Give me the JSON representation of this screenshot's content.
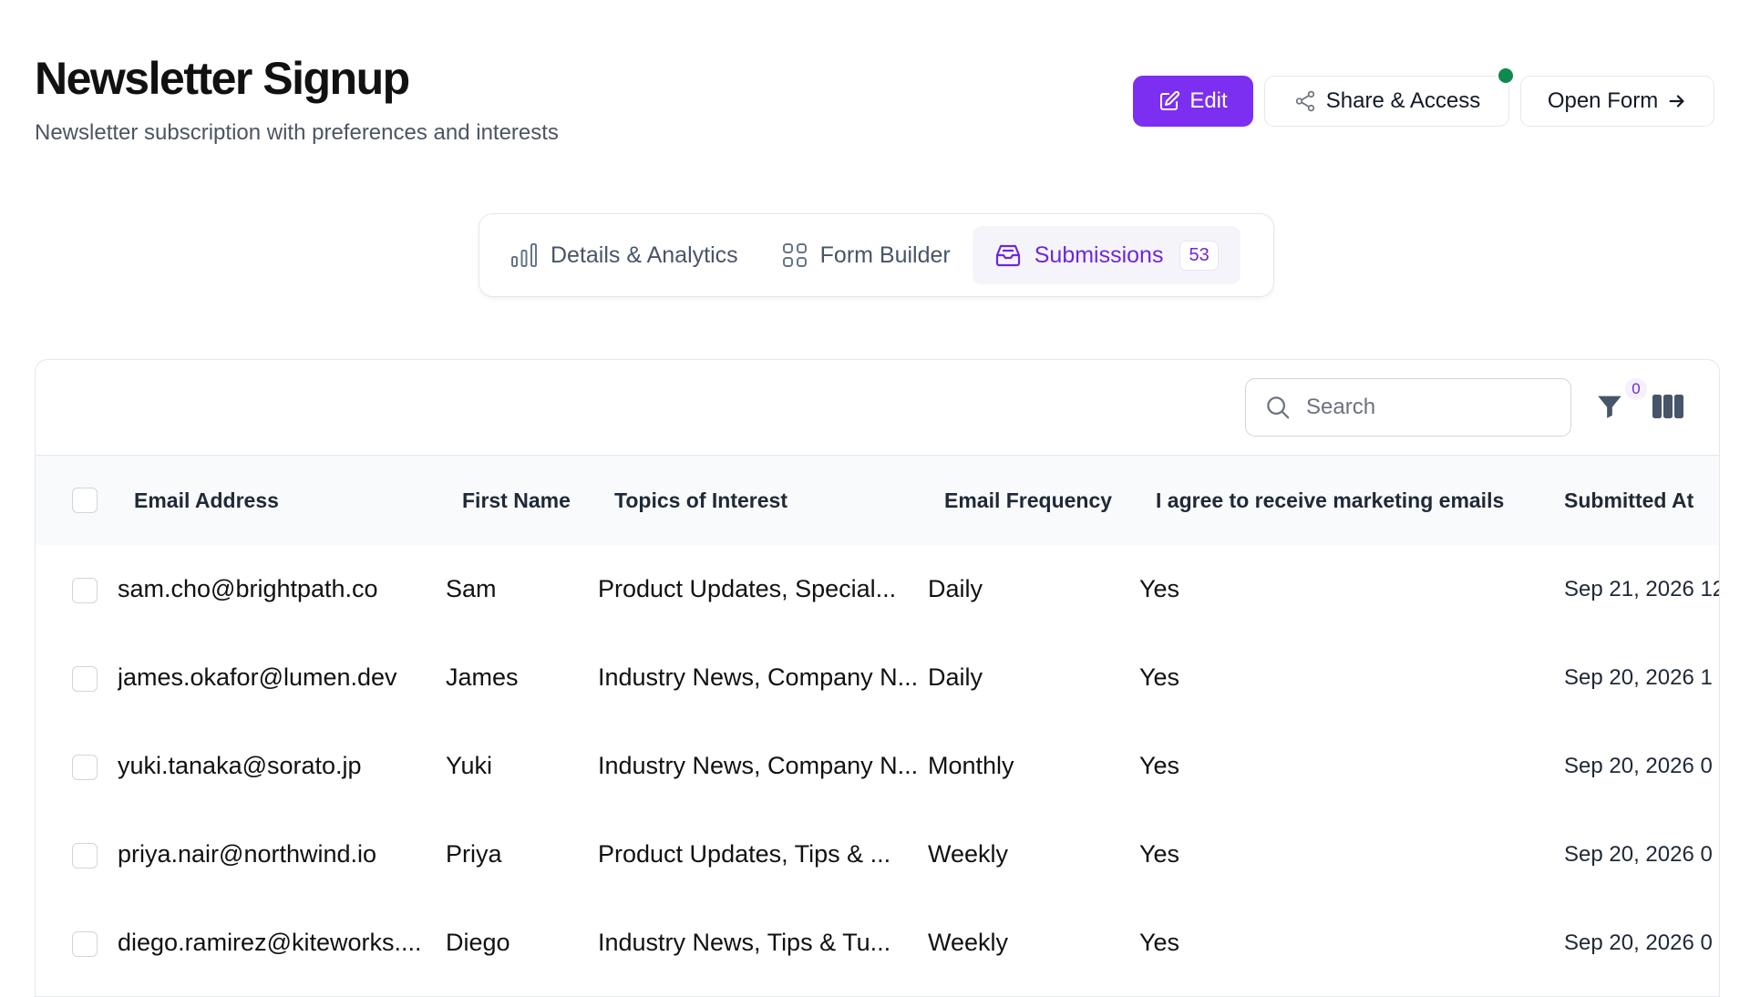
{
  "header": {
    "title": "Newsletter Signup",
    "subtitle": "Newsletter subscription with preferences and interests"
  },
  "actions": {
    "edit_label": "Edit",
    "share_label": "Share & Access",
    "open_label": "Open Form",
    "status_color": "#0f8a4e",
    "primary_color": "#7c2ff0"
  },
  "tabs": [
    {
      "label": "Details & Analytics",
      "icon": "bar-chart-icon"
    },
    {
      "label": "Form Builder",
      "icon": "grid-icon"
    },
    {
      "label": "Submissions",
      "icon": "inbox-icon",
      "count": "53",
      "active": true
    }
  ],
  "toolbar": {
    "search_placeholder": "Search",
    "filter_count": "0"
  },
  "table": {
    "columns": [
      "Email Address",
      "First Name",
      "Topics of Interest",
      "Email Frequency",
      "I agree to receive marketing emails",
      "Submitted At"
    ],
    "rows": [
      {
        "email": "sam.cho@brightpath.co",
        "first_name": "Sam",
        "topics": "Product Updates, Special...",
        "frequency": "Daily",
        "consent": "Yes",
        "submitted": "Sep 21, 2026 12"
      },
      {
        "email": "james.okafor@lumen.dev",
        "first_name": "James",
        "topics": "Industry News, Company N...",
        "frequency": "Daily",
        "consent": "Yes",
        "submitted": "Sep 20, 2026 1"
      },
      {
        "email": "yuki.tanaka@sorato.jp",
        "first_name": "Yuki",
        "topics": "Industry News, Company N...",
        "frequency": "Monthly",
        "consent": "Yes",
        "submitted": "Sep 20, 2026 0"
      },
      {
        "email": "priya.nair@northwind.io",
        "first_name": "Priya",
        "topics": "Product Updates, Tips & ...",
        "frequency": "Weekly",
        "consent": "Yes",
        "submitted": "Sep 20, 2026 0"
      },
      {
        "email": "diego.ramirez@kiteworks....",
        "first_name": "Diego",
        "topics": "Industry News, Tips & Tu...",
        "frequency": "Weekly",
        "consent": "Yes",
        "submitted": "Sep 20, 2026 0"
      }
    ]
  }
}
